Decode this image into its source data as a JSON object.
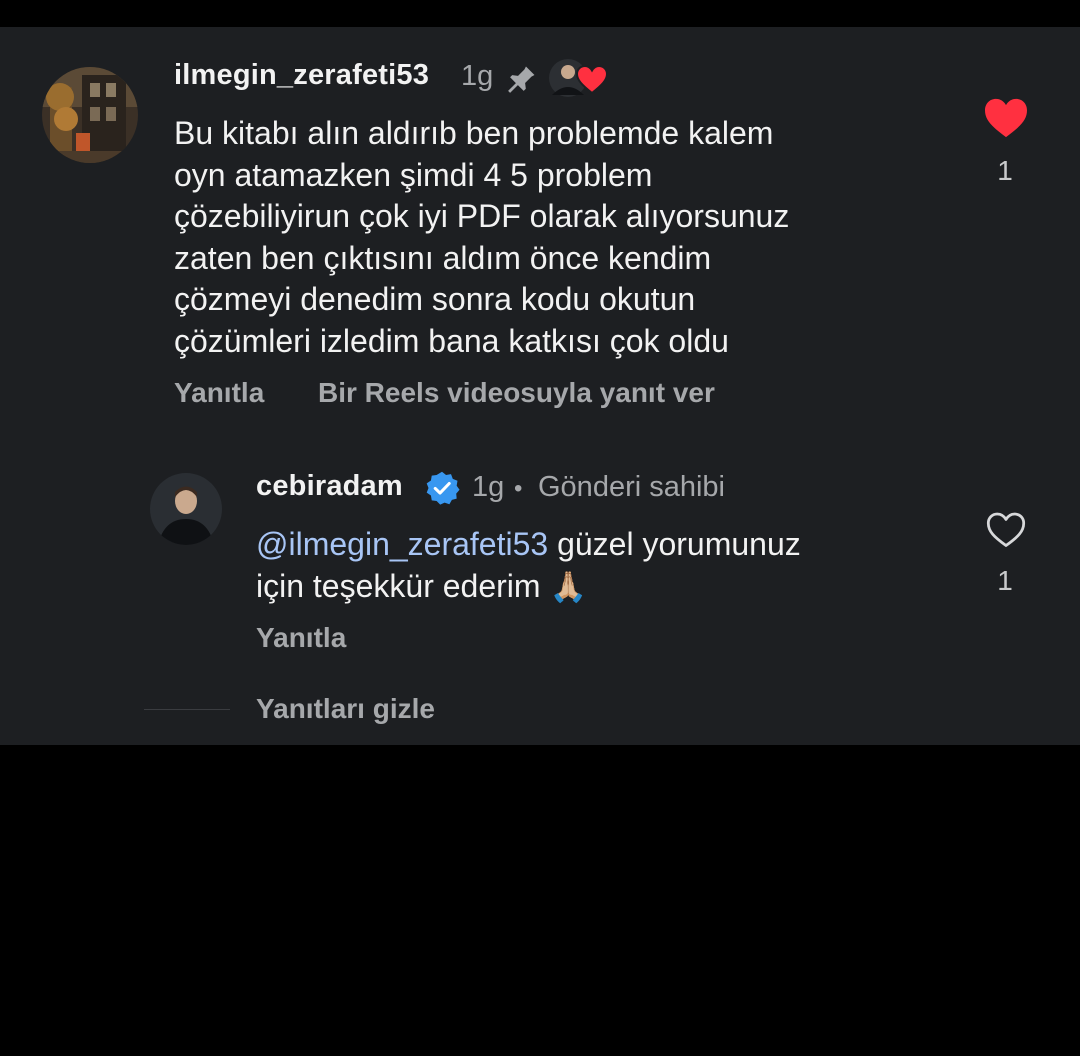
{
  "colors": {
    "background": "#000000",
    "panel": "#1d1f22",
    "text_primary": "#f2f2f2",
    "text_secondary": "#a6a8ab",
    "like_red": "#ff3040",
    "verified_blue": "#3897f0",
    "mention": "#a8c5f5"
  },
  "comment": {
    "username": "ilmegin_zerafeti53",
    "time": "1g",
    "pin_icon": "pin-icon",
    "creator_liked_icon": "creator-liked-heart-icon",
    "text": "Bu kitabı alın aldırıb ben problemde kalem\noyn atamazken şimdi 4 5 problem\nçözebiliyirun çok iyi PDF olarak alıyorsunuz\nzaten ben çıktısını aldım önce kendim\nçözmeyi denedim sonra kodu okutun\nçözümleri izledim bana katkısı çok oldu",
    "reply_label": "Yanıtla",
    "reels_reply_label": "Bir Reels videosuyla yanıt ver",
    "like_icon": "heart-filled-icon",
    "like_count": "1"
  },
  "reply": {
    "username": "cebiradam",
    "verified_icon": "verified-badge-icon",
    "time": "1g",
    "separator": "•",
    "owner_label": "Gönderi sahibi",
    "mention": "@ilmegin_zerafeti53",
    "text_line1_rest": " güzel yorumunuz",
    "text_line2": "için teşekkür ederim",
    "emoji": "🙏🏼",
    "reply_label": "Yanıtla",
    "like_icon": "heart-outline-icon",
    "like_count": "1"
  },
  "hide_replies_label": "Yanıtları gizle"
}
